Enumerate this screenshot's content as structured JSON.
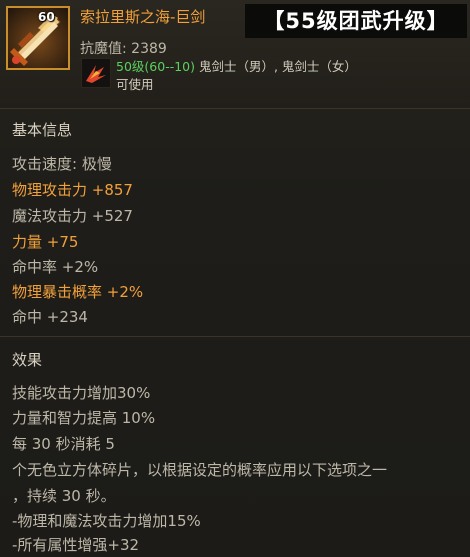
{
  "item": {
    "icon_level": "60",
    "name": "索拉里斯之海-巨剑",
    "tag": "【55级团武升级】",
    "anti_magic": "抗魔值: 2389",
    "req_level": "50级(60--10)",
    "req_classes": " 鬼剑士（男）, 鬼剑士（女）",
    "usable": "可使用"
  },
  "basic": {
    "title": "基本信息",
    "stats": [
      {
        "text": "攻击速度: 极慢",
        "color": "#bdb7a8"
      },
      {
        "text": "物理攻击力 +857",
        "color": "#f2a13a"
      },
      {
        "text": "魔法攻击力 +527",
        "color": "#bdb7a8"
      },
      {
        "text": "力量 +75",
        "color": "#f2a13a"
      },
      {
        "text": "命中率 +2%",
        "color": "#bdb7a8"
      },
      {
        "text": "物理暴击概率 +2%",
        "color": "#f2a13a"
      },
      {
        "text": "命中 +234",
        "color": "#bdb7a8"
      }
    ]
  },
  "effect": {
    "title": "效果",
    "lines": [
      "技能攻击力增加30%",
      "力量和智力提高 10%",
      "每 30 秒消耗 5",
      "个无色立方体碎片，以根据设定的概率应用以下选项之一",
      "，持续 30 秒。",
      "-物理和魔法攻击力增加15%",
      "-所有属性增强+32"
    ]
  },
  "icons": {
    "weapon": "greatsword-icon",
    "class": "ghost-swordsman-class-icon"
  }
}
